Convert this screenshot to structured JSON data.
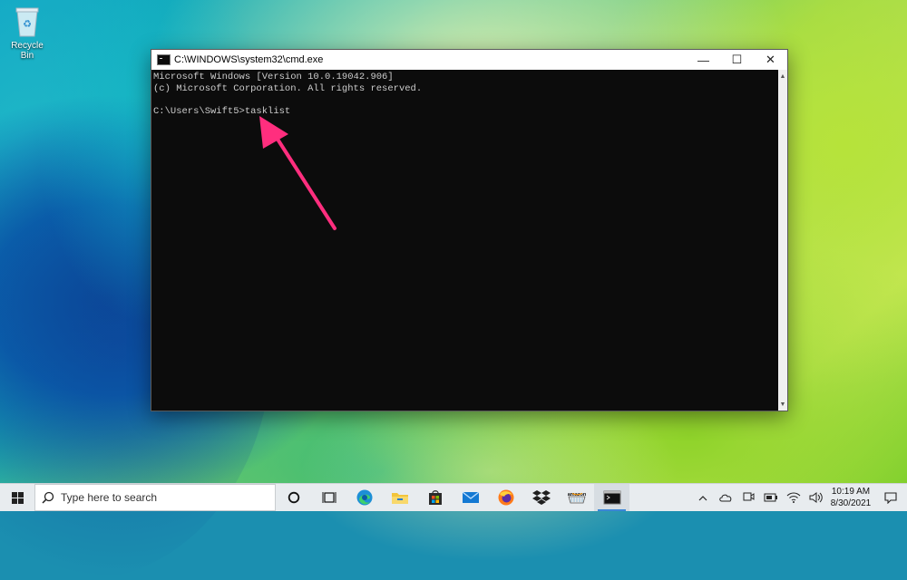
{
  "desktop": {
    "recycle_bin_label": "Recycle Bin"
  },
  "window": {
    "title": "C:\\WINDOWS\\system32\\cmd.exe",
    "minimize_glyph": "—",
    "maximize_glyph": "☐",
    "close_glyph": "✕",
    "console_lines": [
      "Microsoft Windows [Version 10.0.19042.906]",
      "(c) Microsoft Corporation. All rights reserved.",
      "",
      "C:\\Users\\Swift5>tasklist"
    ]
  },
  "annotation": {
    "arrow_color": "#ff2e7e"
  },
  "taskbar": {
    "search_placeholder": "Type here to search",
    "pinned": [
      "cortana-icon",
      "task-view-icon",
      "edge-icon",
      "file-explorer-icon",
      "store-icon",
      "mail-icon",
      "firefox-icon",
      "dropbox-icon",
      "amazon-icon",
      "cmd-icon"
    ],
    "amazon_label": "amazon",
    "clock_time": "10:19 AM",
    "clock_date": "8/30/2021"
  }
}
